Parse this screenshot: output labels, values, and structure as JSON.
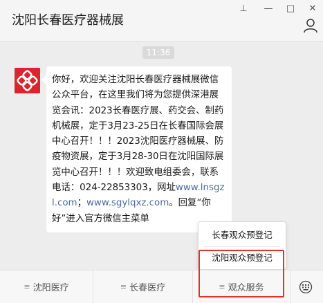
{
  "window": {
    "title": "沈阳长春医疗器械展",
    "pin_glyph": "⊥",
    "minimize_glyph": "—",
    "maximize_glyph": "□",
    "close_glyph": "✕"
  },
  "chat": {
    "timestamp": "11:36",
    "message": {
      "part1": "你好，欢迎关注沈阳长春医疗器械展微信公众平台，在这里我们将为您提供深港展览会讯：2023长春医疗展、药交会、制药机械展，定于3月23-25日在长春国际会展中心召开！！！2023沈阳医疗器械展、防疫物资展，定于3月28-30日在沈阳国际展览中心召开！！！欢迎致电组委会，联系电话：024-22853303，网址",
      "link1": "www.lnsgzl.com",
      "part2": "；",
      "link2": "www.sgylqxz.com",
      "part3": "。回复“你好”进入官方微信主菜单"
    }
  },
  "popup_menu": {
    "items": [
      "长春观众预登记",
      "沈阳观众预登记"
    ]
  },
  "bottom_menu": {
    "tabs": [
      "沈阳医疗",
      "长春医疗",
      "观众服务"
    ],
    "menu_glyph": "≡"
  },
  "colors": {
    "accent_red": "#d9252b",
    "highlight_box": "#e5302a",
    "link": "#4d6a9e"
  }
}
